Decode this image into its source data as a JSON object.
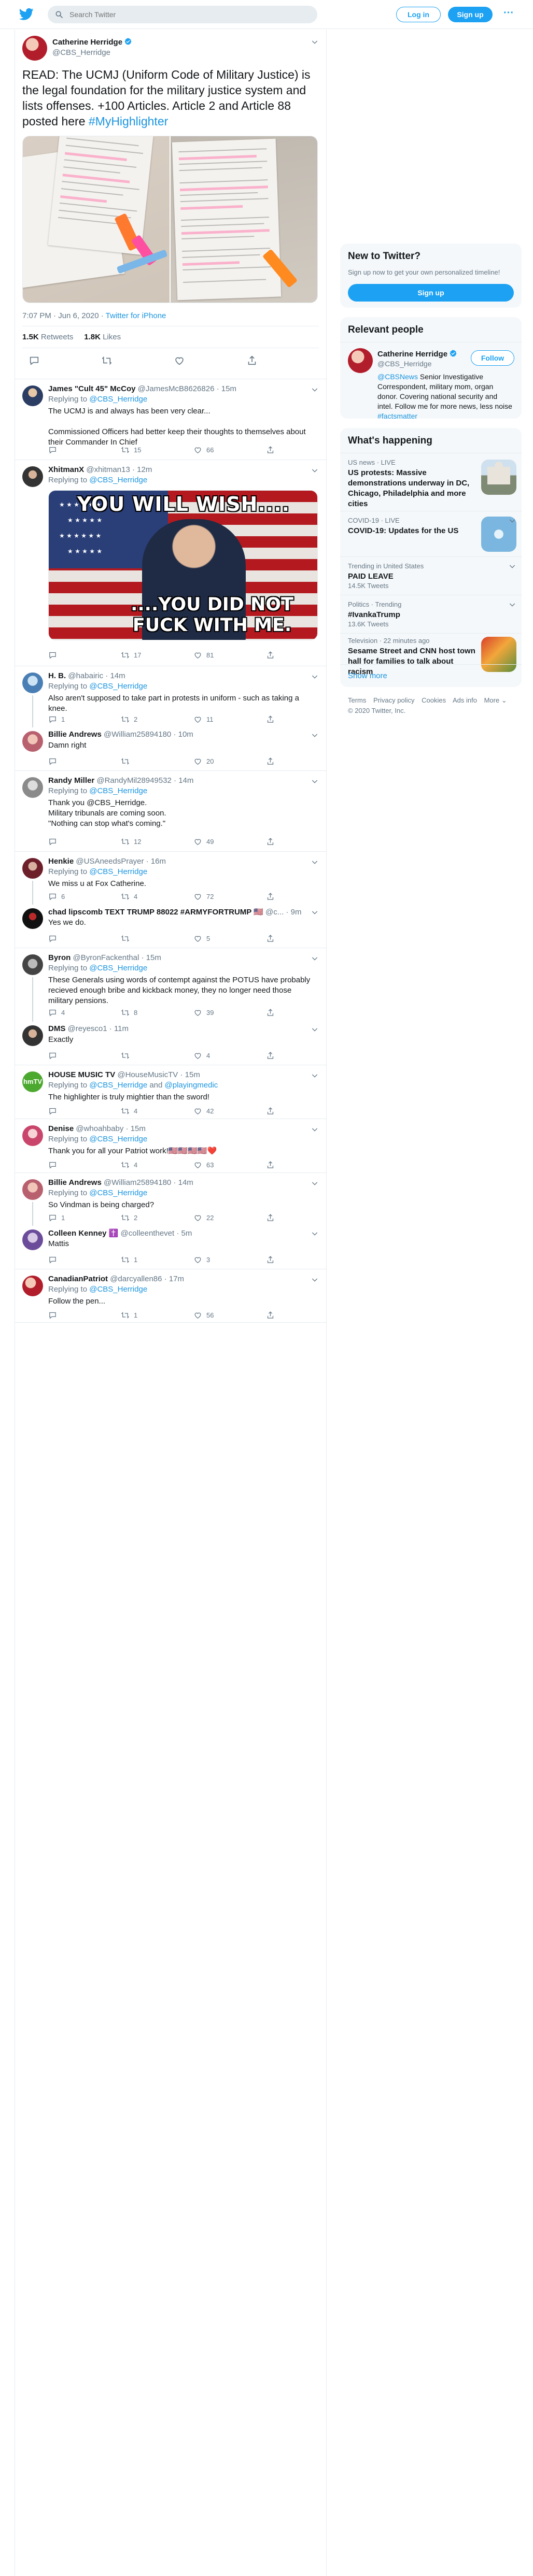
{
  "search": {
    "placeholder": "Search Twitter"
  },
  "header": {
    "login": "Log in",
    "signup": "Sign up"
  },
  "tweet": {
    "author": "Catherine Herridge",
    "handle": "@CBS_Herridge",
    "text_prefix": "READ: The UCMJ (Uniform Code of Military Justice) is the legal foundation for the military justice system and lists offenses.  +100 Articles. Article 2 and Article 88 posted here ",
    "hashtag": "#MyHighlighter",
    "time": "7:07 PM · Jun 6, 2020",
    "source": "Twitter for iPhone",
    "retweets_count": "1.5K",
    "retweets_label": "Retweets",
    "likes_count": "1.8K",
    "likes_label": "Likes"
  },
  "replies": [
    {
      "name": "James \"Cult 45\" McCoy",
      "handle": "@JamesMcB8626826",
      "time": "15m",
      "replying": "@CBS_Herridge",
      "text": "The UCMJ is and always has been very clear...\n\nCommissioned Officers had better keep their thoughts to themselves about their Commander In Chief",
      "reply_count": "",
      "rt_count": "15",
      "like_count": "66"
    },
    {
      "name": "XhitmanX",
      "handle": "@xhitman13",
      "time": "12m",
      "replying": "@CBS_Herridge",
      "text": "",
      "meme_top": "YOU WILL WISH....",
      "meme_bottom": "....YOU DID NOT FUCK WITH ME.",
      "reply_count": "",
      "rt_count": "17",
      "like_count": "81"
    },
    {
      "name": "H. B.",
      "handle": "@habairic",
      "time": "14m",
      "replying": "@CBS_Herridge",
      "text": "Also aren't supposed to take part in protests in uniform - such as taking a knee.",
      "reply_count": "1",
      "rt_count": "2",
      "like_count": "11"
    },
    {
      "name": "Billie Andrews",
      "handle": "@William25894180",
      "time": "10m",
      "replying": "",
      "text": "Damn right",
      "reply_count": "",
      "rt_count": "",
      "like_count": "20"
    },
    {
      "name": "Randy Miller",
      "handle": "@RandyMil28949532",
      "time": "14m",
      "replying": "@CBS_Herridge",
      "replying2": "Thank you @CBS_Herridge.",
      "text": "Military tribunals are coming soon.\n\"Nothing can stop what's coming.\"",
      "reply_count": "",
      "rt_count": "12",
      "like_count": "49"
    },
    {
      "name": "Henkie",
      "handle": "@USAneedsPrayer",
      "time": "16m",
      "replying": "@CBS_Herridge",
      "text": "We miss u at Fox Catherine.",
      "reply_count": "6",
      "rt_count": "4",
      "like_count": "72"
    },
    {
      "name": "chad lipscomb TEXT TRUMP 88022 #ARMYFORTRUMP 🇺🇸",
      "handle": "@c...",
      "time": "9m",
      "replying": "",
      "text": "Yes we do.",
      "reply_count": "",
      "rt_count": "",
      "like_count": "5"
    },
    {
      "name": "Byron",
      "handle": "@ByronFackenthal",
      "time": "15m",
      "replying": "@CBS_Herridge",
      "text": "These Generals using words of contempt against the POTUS have probably recieved enough bribe and kickback money, they no longer need those military pensions.",
      "reply_count": "4",
      "rt_count": "8",
      "like_count": "39"
    },
    {
      "name": "DMS",
      "handle": "@reyesco1",
      "time": "11m",
      "replying": "",
      "text": "Exactly",
      "reply_count": "",
      "rt_count": "",
      "like_count": "4"
    },
    {
      "name": "HOUSE MUSIC TV",
      "handle": "@HouseMusicTV",
      "time": "15m",
      "replying": "@CBS_Herridge",
      "replying_and": "and",
      "replying_other": "@playingmedic",
      "text": "The highlighter is truly mightier than the sword!",
      "reply_count": "",
      "rt_count": "4",
      "like_count": "42",
      "avatar_text": "hmTV"
    },
    {
      "name": "Denise",
      "handle": "@whoahbaby",
      "time": "15m",
      "replying": "@CBS_Herridge",
      "text": "Thank you for all your Patriot work!🇺🇸🇺🇸🇺🇸🇺🇸❤️",
      "reply_count": "",
      "rt_count": "4",
      "like_count": "63"
    },
    {
      "name": "Billie Andrews",
      "handle": "@William25894180",
      "time": "14m",
      "replying": "@CBS_Herridge",
      "text": "So Vindman is being charged?",
      "reply_count": "1",
      "rt_count": "2",
      "like_count": "22"
    },
    {
      "name": "Colleen Kenney ✝️",
      "handle": "@colleenthevet",
      "time": "5m",
      "replying": "",
      "text": "Mattis",
      "reply_count": "",
      "rt_count": "1",
      "like_count": "3"
    },
    {
      "name": "CanadianPatriot",
      "handle": "@darcyallen86",
      "time": "17m",
      "replying": "@CBS_Herridge",
      "text": "Follow the pen...",
      "reply_count": "",
      "rt_count": "1",
      "like_count": "56"
    }
  ],
  "sidebar": {
    "new_title": "New to Twitter?",
    "new_sub": "Sign up now to get your own personalized timeline!",
    "new_button": "Sign up",
    "relevant_title": "Relevant people",
    "person_name": "Catherine Herridge",
    "person_handle": "@CBS_Herridge",
    "follow": "Follow",
    "bio_tag": "@CBSNews",
    "bio_text": " Senior Investigative Correspondent, military mom, organ donor. Covering national security and intel. Follow me for more news, less noise ",
    "bio_hashtag": "#factsmatter",
    "happening_title": "What's happening",
    "trends": [
      {
        "category": "US news · LIVE",
        "title": "US protests: Massive demonstrations underway in DC, Chicago, Philadelphia and more cities",
        "sub": ""
      },
      {
        "category": "COVID-19 · LIVE",
        "title": "COVID-19: Updates for the US",
        "sub": ""
      },
      {
        "category": "Trending in United States",
        "title": "PAID LEAVE",
        "sub": "14.5K Tweets"
      },
      {
        "category": "Politics · Trending",
        "title": "#IvankaTrump",
        "sub": "13.6K Tweets"
      },
      {
        "category": "Television · 22 minutes ago",
        "title": "Sesame Street and CNN host town hall for families to talk about racism",
        "sub": ""
      }
    ],
    "show_more": "Show more",
    "footer_links": [
      "Terms",
      "Privacy policy",
      "Cookies",
      "Ads info",
      "More ⌄"
    ],
    "copyright": "© 2020 Twitter, Inc."
  },
  "colors": {
    "accent": "#1da1f2",
    "text": "#14171a",
    "muted": "#657786",
    "border": "#e6ecf0"
  },
  "icons": {
    "logo": "twitter-bird-icon",
    "search": "search-icon",
    "reply": "reply-icon",
    "retweet": "retweet-icon",
    "like": "heart-icon",
    "share": "share-icon",
    "verified": "verified-badge-icon",
    "chevron": "chevron-down-icon",
    "more": "more-icon"
  }
}
